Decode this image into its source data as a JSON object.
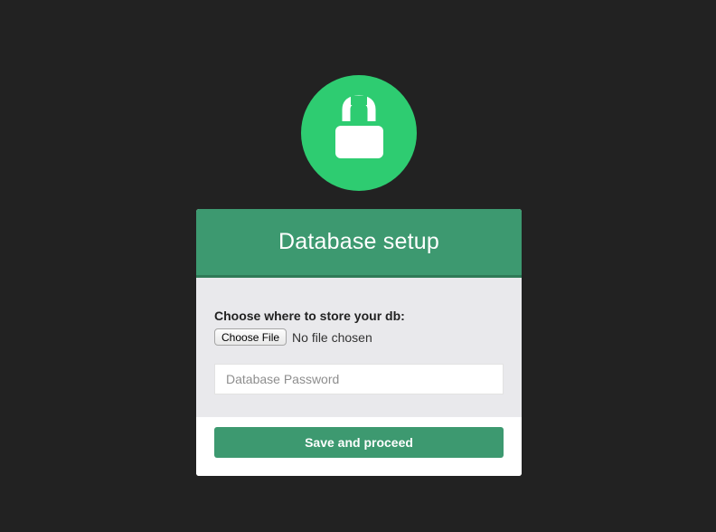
{
  "logo": {
    "icon": "lock-icon",
    "circle_color": "#2ecc71"
  },
  "card": {
    "title": "Database setup",
    "header_color": "#3d9970",
    "store_label": "Choose where to store your db:",
    "file_button_label": "Choose File",
    "file_status": "No file chosen",
    "password_placeholder": "Database Password",
    "password_value": "",
    "submit_label": "Save and proceed"
  }
}
